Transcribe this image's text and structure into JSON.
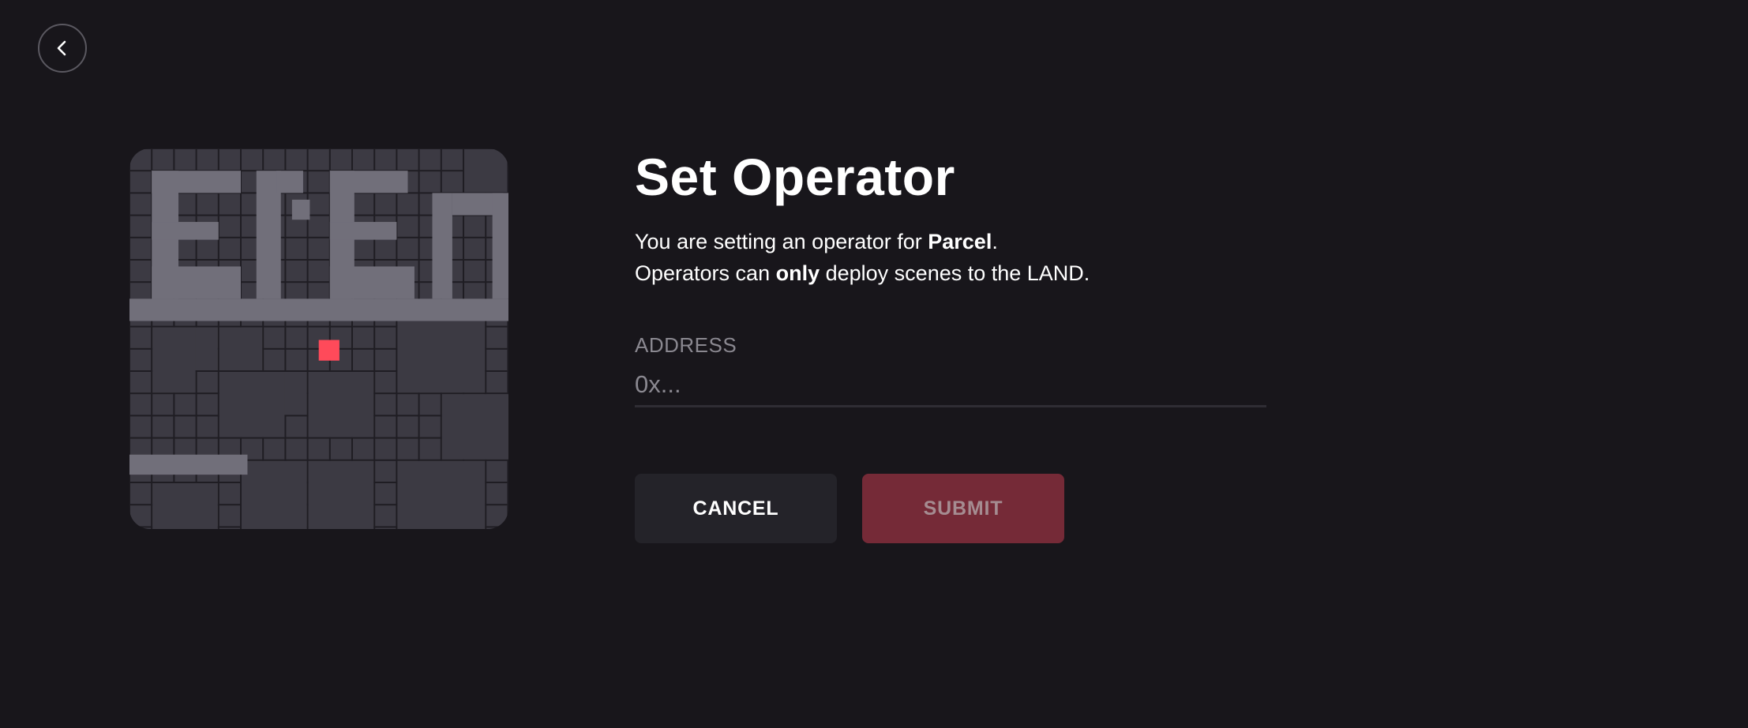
{
  "nav": {
    "back_icon": "chevron-left-icon"
  },
  "header": {
    "title": "Set Operator"
  },
  "description": {
    "line1_prefix": "You are setting an operator for ",
    "line1_bold": "Parcel",
    "line1_suffix": ".",
    "line2_prefix": "Operators can ",
    "line2_bold": "only",
    "line2_suffix": " deploy scenes to the LAND."
  },
  "address_field": {
    "label": "ADDRESS",
    "placeholder": "0x...",
    "value": ""
  },
  "actions": {
    "cancel_label": "CANCEL",
    "submit_label": "SUBMIT"
  },
  "colors": {
    "background": "#18161b",
    "parcel_highlight": "#ff4a5a",
    "map_road": "#716f7a",
    "map_parcel": "#3c3a43",
    "submit_disabled": "#752a37"
  }
}
